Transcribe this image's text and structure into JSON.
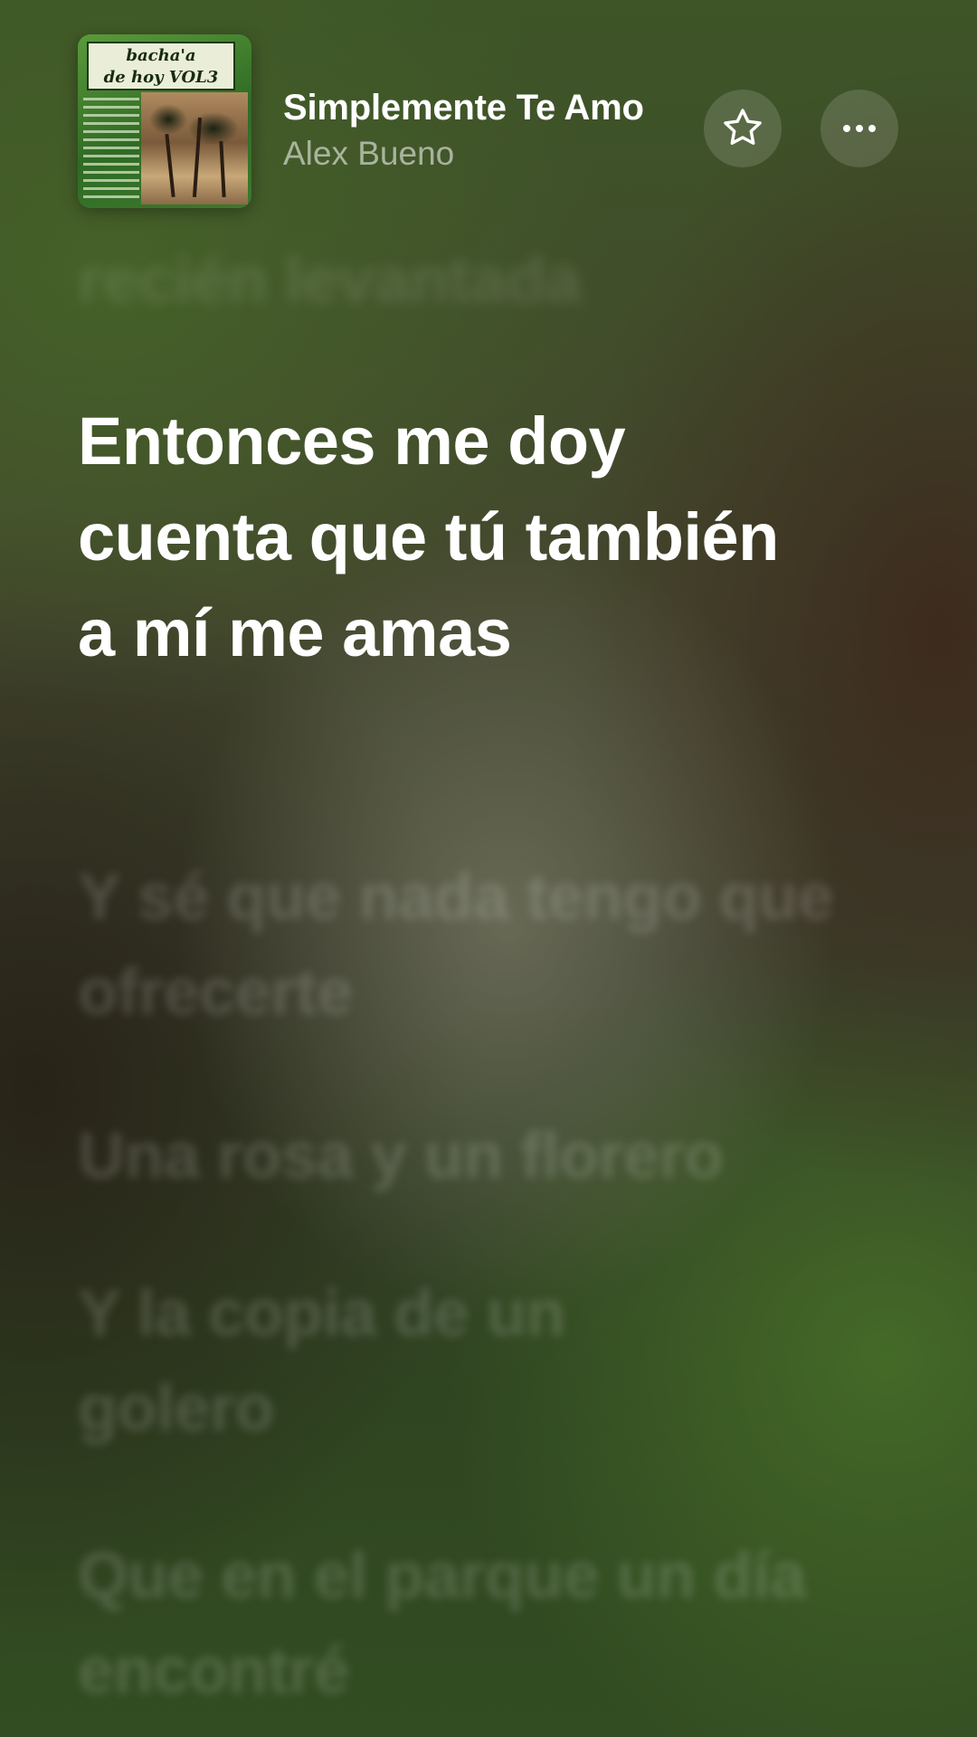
{
  "now_playing": {
    "title": "Simplemente Te Amo",
    "artist": "Alex Bueno",
    "cover_art_text": "bacha'a\nde hoy VOL3"
  },
  "actions": {
    "favorite_icon": "star-outline-icon",
    "more_icon": "ellipsis-icon"
  },
  "lyrics": {
    "previous_line": "recién levantada",
    "current_line": "Entonces me doy cuenta que tú también a mí me amas",
    "upcoming_lines": [
      "Y sé que nada tengo que ofrecerte",
      "Una rosa y un florero",
      "Y la copia de un golero",
      "Que en el parque un día encontré"
    ]
  },
  "colors": {
    "current_lyric": "#ffffff",
    "dim_lyric": "rgba(255,255,255,0.16)",
    "artist_text": "rgba(255,255,255,0.55)"
  }
}
